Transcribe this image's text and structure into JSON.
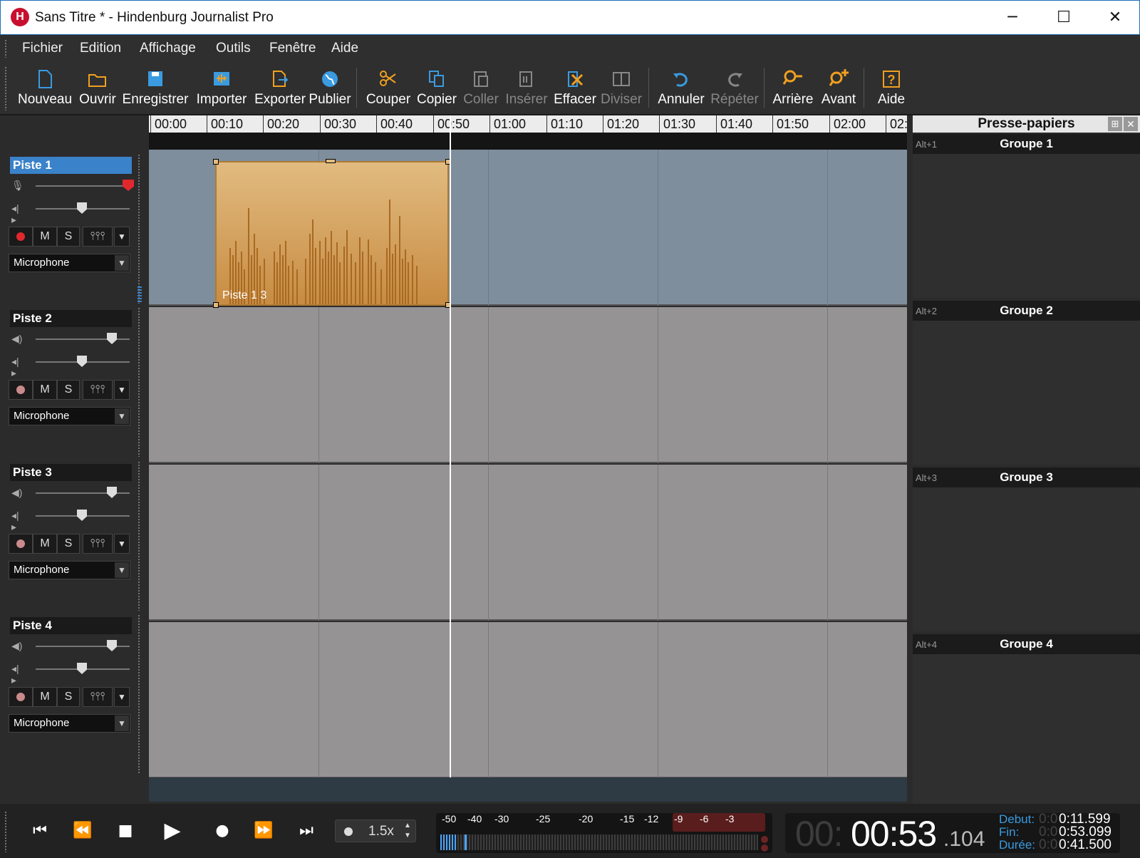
{
  "window": {
    "title": "Sans Titre * - Hindenburg Journalist Pro",
    "logo": "H",
    "minimize": "─",
    "maximize": "☐",
    "close": "✕"
  },
  "menu": [
    "Fichier",
    "Edition",
    "Affichage",
    "Outils",
    "Fenêtre",
    "Aide"
  ],
  "toolbar": [
    {
      "label": "Nouveau",
      "icon": "new-file-icon",
      "enabled": true
    },
    {
      "label": "Ouvrir",
      "icon": "folder-icon",
      "enabled": true
    },
    {
      "label": "Enregistrer",
      "icon": "save-icon",
      "enabled": true
    },
    {
      "label": "Importer",
      "icon": "import-icon",
      "enabled": true
    },
    {
      "label": "Exporter",
      "icon": "export-icon",
      "enabled": true
    },
    {
      "label": "Publier",
      "icon": "globe-icon",
      "enabled": true
    },
    {
      "label": "Couper",
      "icon": "scissors-icon",
      "enabled": true
    },
    {
      "label": "Copier",
      "icon": "copy-icon",
      "enabled": true
    },
    {
      "label": "Coller",
      "icon": "paste-icon",
      "enabled": false
    },
    {
      "label": "Insérer",
      "icon": "insert-icon",
      "enabled": false
    },
    {
      "label": "Effacer",
      "icon": "erase-icon",
      "enabled": true
    },
    {
      "label": "Diviser",
      "icon": "split-icon",
      "enabled": false
    },
    {
      "label": "Annuler",
      "icon": "undo-icon",
      "enabled": true
    },
    {
      "label": "Répéter",
      "icon": "redo-icon",
      "enabled": false
    },
    {
      "label": "Arrière",
      "icon": "search-back-icon",
      "enabled": true
    },
    {
      "label": "Avant",
      "icon": "search-forward-icon",
      "enabled": true
    },
    {
      "label": "Aide",
      "icon": "help-icon",
      "enabled": true
    }
  ],
  "ruler": [
    "00:00",
    "00:10",
    "00:20",
    "00:30",
    "00:40",
    "00:50",
    "01:00",
    "01:10",
    "01:20",
    "01:30",
    "01:40",
    "01:50",
    "02:00",
    "02:"
  ],
  "tracks": [
    {
      "name": "Piste 1",
      "selected": true,
      "armed": true,
      "device": "Microphone",
      "level": 1.0,
      "pan": 0.5
    },
    {
      "name": "Piste 2",
      "selected": false,
      "armed": false,
      "device": "Microphone",
      "level": 0.8,
      "pan": 0.5
    },
    {
      "name": "Piste 3",
      "selected": false,
      "armed": false,
      "device": "Microphone",
      "level": 0.8,
      "pan": 0.5
    },
    {
      "name": "Piste 4",
      "selected": false,
      "armed": false,
      "device": "Microphone",
      "level": 0.8,
      "pan": 0.5
    }
  ],
  "track_buttons": {
    "mute": "M",
    "solo": "S",
    "mixer": "⫯⫯⫯",
    "menu": "▼",
    "device_arrow": "▼"
  },
  "clip": {
    "label": "Piste 1 3",
    "track": "Piste 1"
  },
  "clipboard": {
    "title": "Presse-papiers",
    "pin": "⊞",
    "close": "✕",
    "groups": [
      {
        "key": "Alt+1",
        "name": "Groupe 1"
      },
      {
        "key": "Alt+2",
        "name": "Groupe 2"
      },
      {
        "key": "Alt+3",
        "name": "Groupe 3"
      },
      {
        "key": "Alt+4",
        "name": "Groupe 4"
      }
    ]
  },
  "transport": {
    "speed": "1.5x",
    "meter_ticks": [
      "-50",
      "-40",
      "-30",
      "-25",
      "-20",
      "-15",
      "-12",
      "-9",
      "-6",
      "-3"
    ]
  },
  "time": {
    "hours": "00:",
    "main": "00:53",
    "ms": ".104",
    "debut_label": "Debut:",
    "debut_dim": "0:0",
    "debut": "0:11.599",
    "fin_label": "Fin:",
    "fin_dim": "0:0",
    "fin": "0:53.099",
    "duree_label": "Durée:",
    "duree_dim": "0:0",
    "duree": "0:41.500"
  },
  "colors": {
    "accent": "#3a82c9",
    "record": "#e0282e",
    "clip": "#d9a765",
    "selected_lane": "#7f8e9c"
  }
}
